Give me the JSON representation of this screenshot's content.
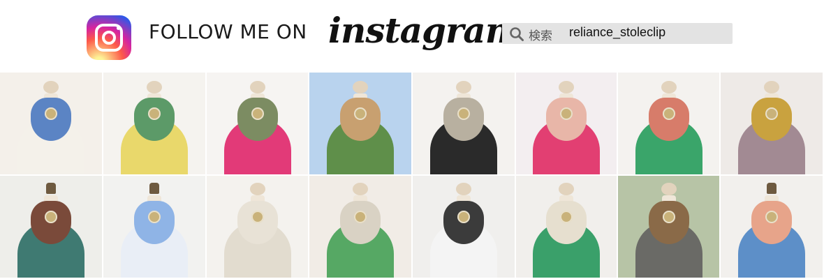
{
  "header": {
    "follow_text": "FOLLOW ME ON",
    "wordmark": "instagram",
    "logo_icon": "instagram-logo-icon",
    "search": {
      "icon": "search-icon",
      "label": "検索",
      "value": "reliance_stoleclip"
    }
  },
  "colors": {
    "search_bg": "#e3e3e3",
    "wordmark": "#111111"
  },
  "grid": {
    "columns": 8,
    "rows": 2,
    "tiles": [
      {
        "scarf": "#5b84c4",
        "body": "#f4f1ea",
        "bg": "#f4f0ea"
      },
      {
        "scarf": "#5c9a68",
        "body": "#e9d86b",
        "bg": "#f5f3ef"
      },
      {
        "scarf": "#7c8c62",
        "body": "#e23a78",
        "bg": "#f6f4f2"
      },
      {
        "scarf": "#c8a070",
        "body": "#5f8f4a",
        "bg": "#b9d3ee"
      },
      {
        "scarf": "#b8b0a0",
        "body": "#2a2a2a",
        "bg": "#f4f2ef"
      },
      {
        "scarf": "#e8b6a8",
        "body": "#e23f72",
        "bg": "#f3eef0"
      },
      {
        "scarf": "#d77c6a",
        "body": "#3aa56a",
        "bg": "#f4f2ef"
      },
      {
        "scarf": "#c9a23f",
        "body": "#a28a93",
        "bg": "#eeeae7"
      },
      {
        "scarf": "#7a4a3a",
        "body": "#3f7a72",
        "bg": "#eeeeea"
      },
      {
        "scarf": "#8fb4e6",
        "body": "#e9eef6",
        "bg": "#f2f2f0"
      },
      {
        "scarf": "#e8e2d6",
        "body": "#e2dccf",
        "bg": "#f4f2ee"
      },
      {
        "scarf": "#d9d2c4",
        "body": "#56a864",
        "bg": "#f1ece6"
      },
      {
        "scarf": "#3b3b3b",
        "body": "#f4f4f4",
        "bg": "#f0efed"
      },
      {
        "scarf": "#e6dfcf",
        "body": "#3aa06a",
        "bg": "#f1efec"
      },
      {
        "scarf": "#8a6a48",
        "body": "#6a6a66",
        "bg": "#b7c4a6"
      },
      {
        "scarf": "#e7a48a",
        "body": "#5d8fc8",
        "bg": "#f2f0ed"
      }
    ]
  }
}
